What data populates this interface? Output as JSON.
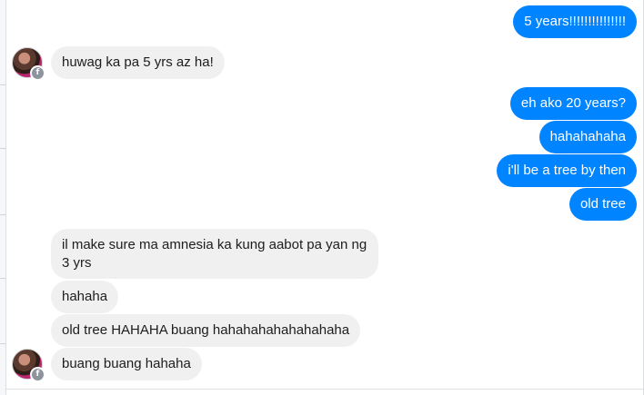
{
  "conversation": {
    "outgoing": [
      {
        "text": "5 years!!!!!!!!!!!!!!!"
      },
      {
        "text": "eh ako 20 years?"
      },
      {
        "text": "hahahahaha"
      },
      {
        "text": "i'll be a tree by then"
      },
      {
        "text": "old tree"
      }
    ],
    "incoming": [
      {
        "text": "huwag ka pa 5 yrs az ha!"
      },
      {
        "text": "il make sure ma amnesia ka kung aabot pa yan ng 3 yrs"
      },
      {
        "text": "hahaha"
      },
      {
        "text": "old tree HAHAHA buang hahahahahahahahaha"
      },
      {
        "text": "buang buang hahaha"
      }
    ],
    "avatar_badge_glyph": "f",
    "colors": {
      "outgoing_bubble": "#0084ff",
      "incoming_bubble": "#f1f0f0"
    }
  }
}
